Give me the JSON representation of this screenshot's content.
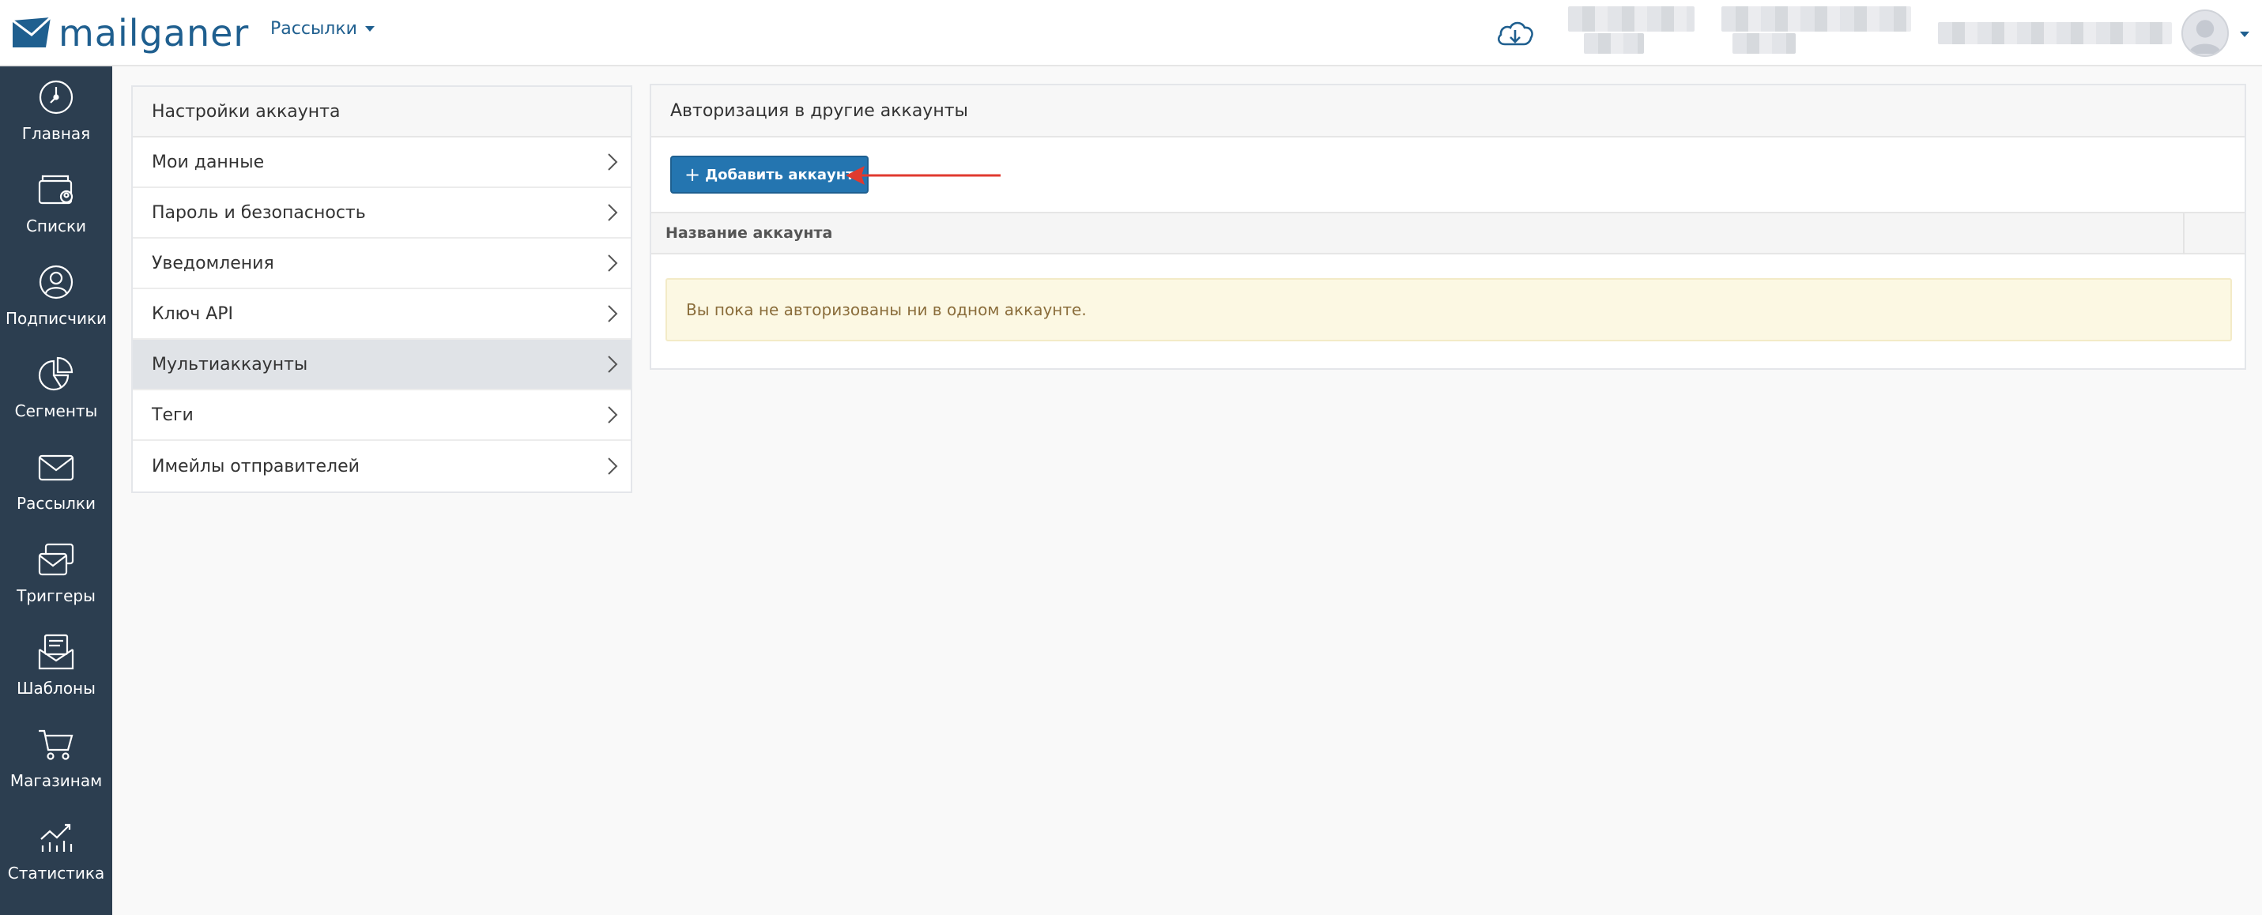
{
  "header": {
    "logo_text": "mailganer",
    "menu_label": "Рассылки"
  },
  "sidebar": {
    "items": [
      {
        "label": "Главная",
        "icon": "dashboard-icon"
      },
      {
        "label": "Списки",
        "icon": "lists-icon"
      },
      {
        "label": "Подписчики",
        "icon": "user-icon"
      },
      {
        "label": "Сегменты",
        "icon": "segments-icon"
      },
      {
        "label": "Рассылки",
        "icon": "envelope-icon"
      },
      {
        "label": "Триггеры",
        "icon": "triggers-icon"
      },
      {
        "label": "Шаблоны",
        "icon": "templates-icon"
      },
      {
        "label": "Магазинам",
        "icon": "cart-icon"
      },
      {
        "label": "Статистика",
        "icon": "stats-icon"
      }
    ]
  },
  "settings": {
    "title": "Настройки аккаунта",
    "items": [
      {
        "label": "Мои данные"
      },
      {
        "label": "Пароль и безопасность"
      },
      {
        "label": "Уведомления"
      },
      {
        "label": "Ключ API"
      },
      {
        "label": "Мультиаккаунты",
        "active": true
      },
      {
        "label": "Теги"
      },
      {
        "label": "Имейлы отправителей"
      }
    ]
  },
  "main": {
    "title": "Авторизация в другие аккаунты",
    "add_button_label": "Добавить аккаунт",
    "column_header": "Название аккаунта",
    "empty_message": "Вы пока не авторизованы ни в одном аккаунте."
  },
  "colors": {
    "sidebar_bg": "#2c3e50",
    "brand": "#1f5f8f",
    "button": "#2475b0",
    "alert_bg": "#fcf8e3",
    "arrow": "#e03a2f"
  }
}
